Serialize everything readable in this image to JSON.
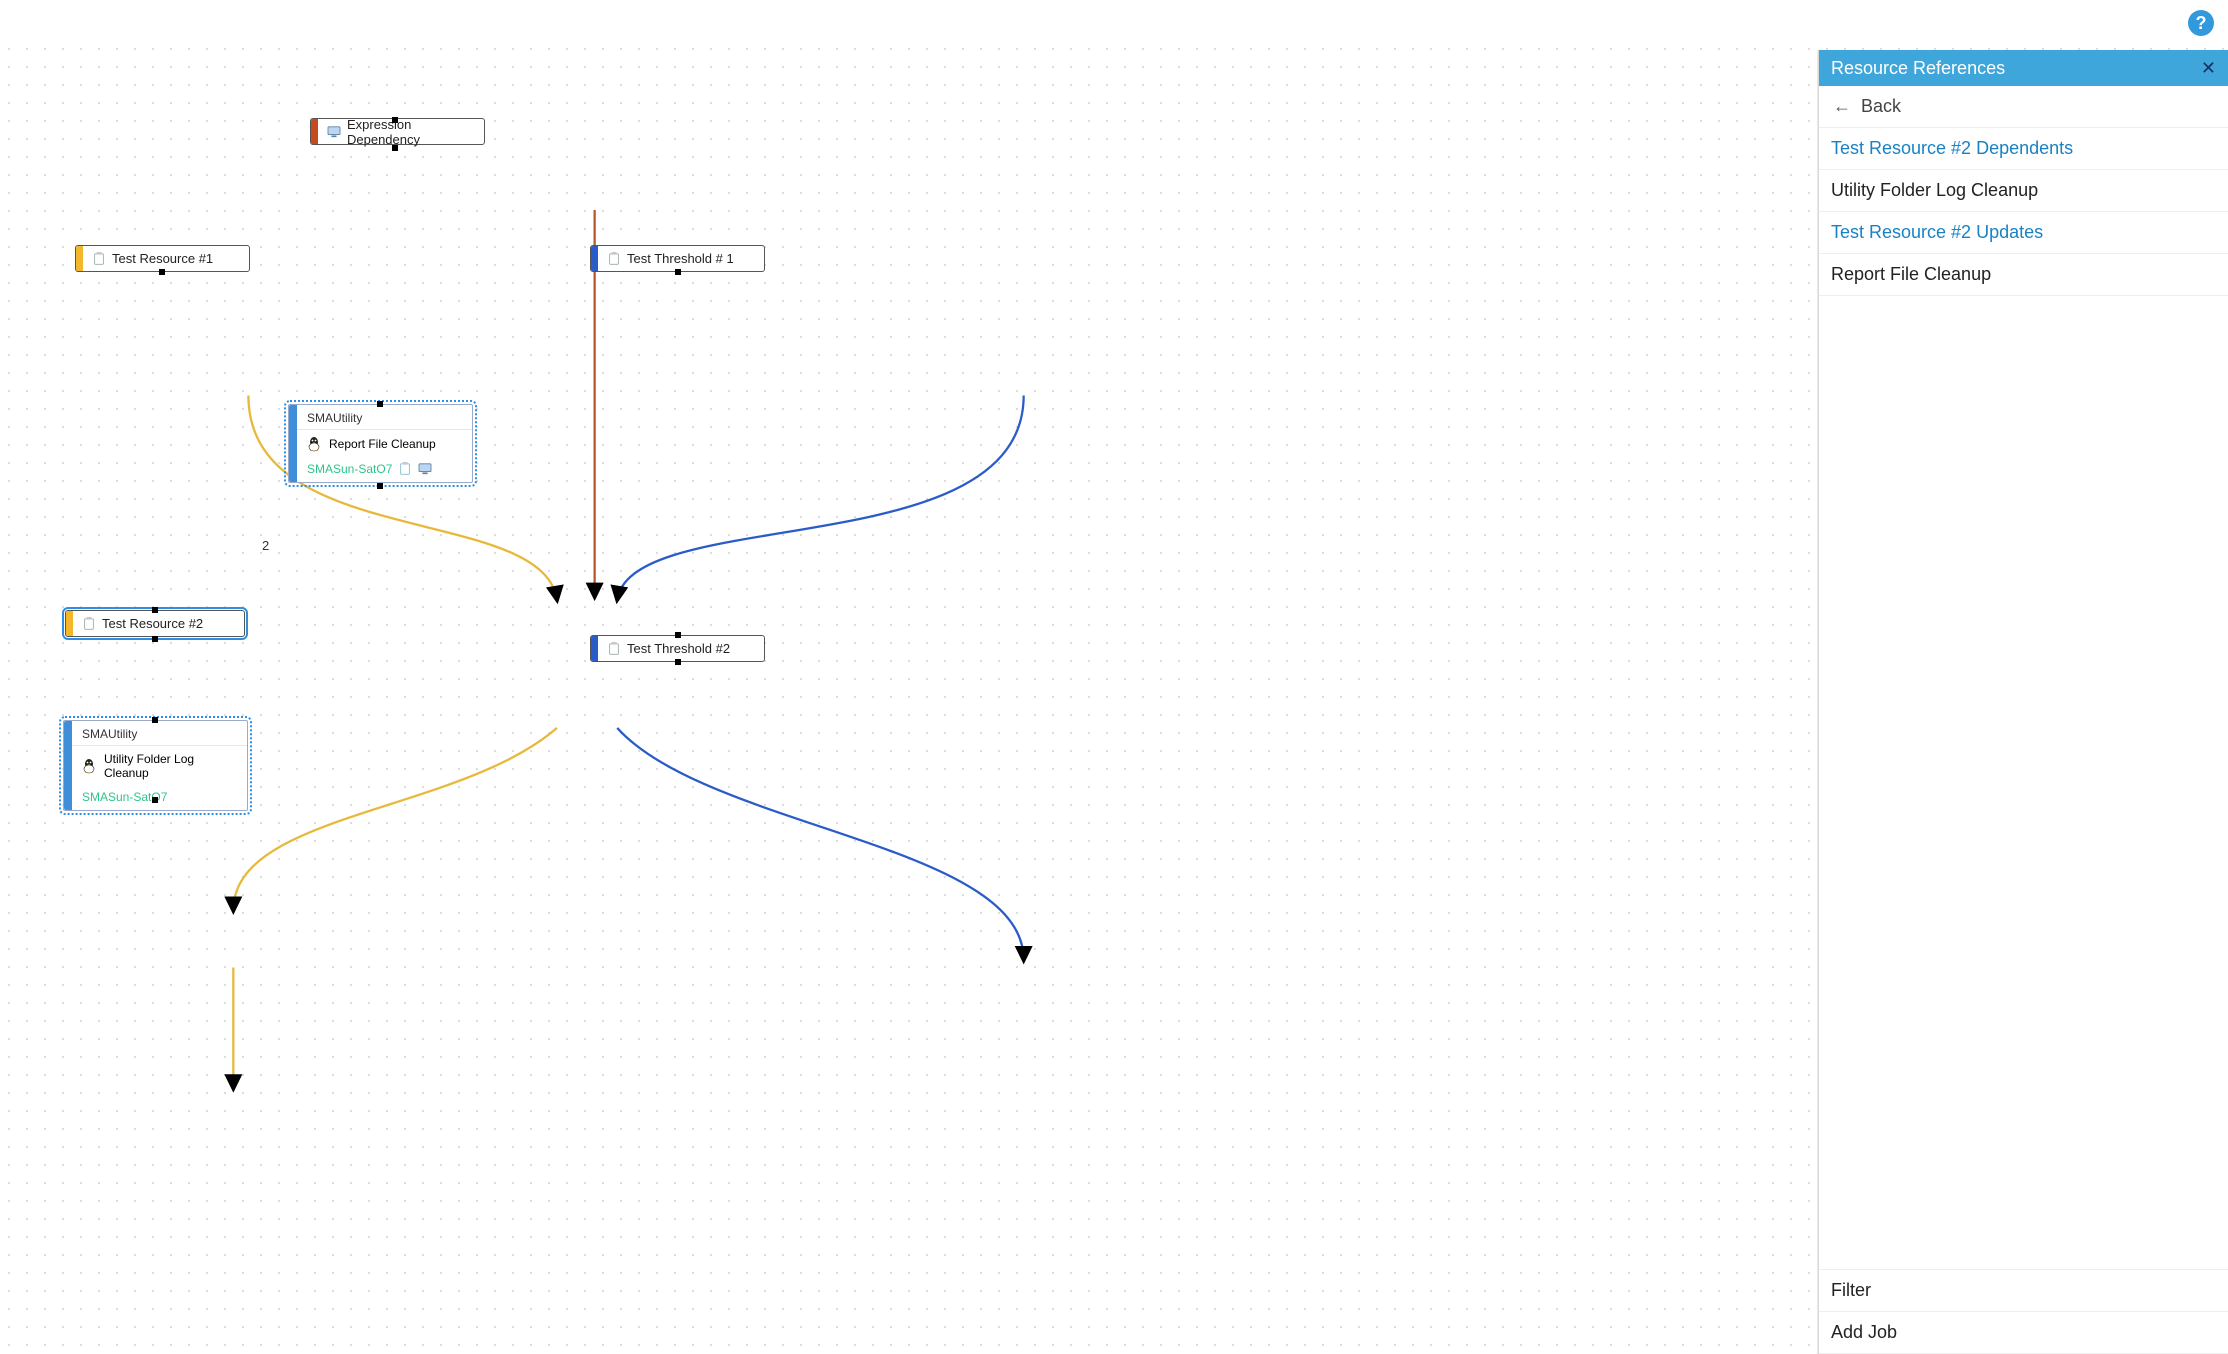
{
  "help_label": "?",
  "panel": {
    "title": "Resource References",
    "back_label": "Back",
    "sections": [
      {
        "heading": "Test Resource #2 Dependents",
        "entry": "Utility Folder Log Cleanup"
      },
      {
        "heading": "Test Resource #2 Updates",
        "entry": "Report File Cleanup"
      }
    ],
    "filter_label": "Filter",
    "add_job_label": "Add Job"
  },
  "nodes": {
    "expr_dep": {
      "label": "Expression Dependency",
      "strip": "#c84b1d"
    },
    "test_res1": {
      "label": "Test Resource #1",
      "strip": "#f3b72b"
    },
    "test_thr1": {
      "label": "Test Threshold # 1",
      "strip": "#2a5cc9"
    },
    "test_res2": {
      "label": "Test Resource #2",
      "strip": "#f3b72b"
    },
    "test_thr2": {
      "label": "Test Threshold #2",
      "strip": "#2a5cc9"
    }
  },
  "big_nodes": {
    "report": {
      "header": "SMAUtility",
      "title": "Report File Cleanup",
      "footer": "SMASun-SatO7"
    },
    "utility": {
      "header": "SMAUtility",
      "title": "Utility Folder Log Cleanup",
      "footer": "SMASun-SatO7"
    }
  },
  "edge_annotations": {
    "res2_count": "2"
  }
}
